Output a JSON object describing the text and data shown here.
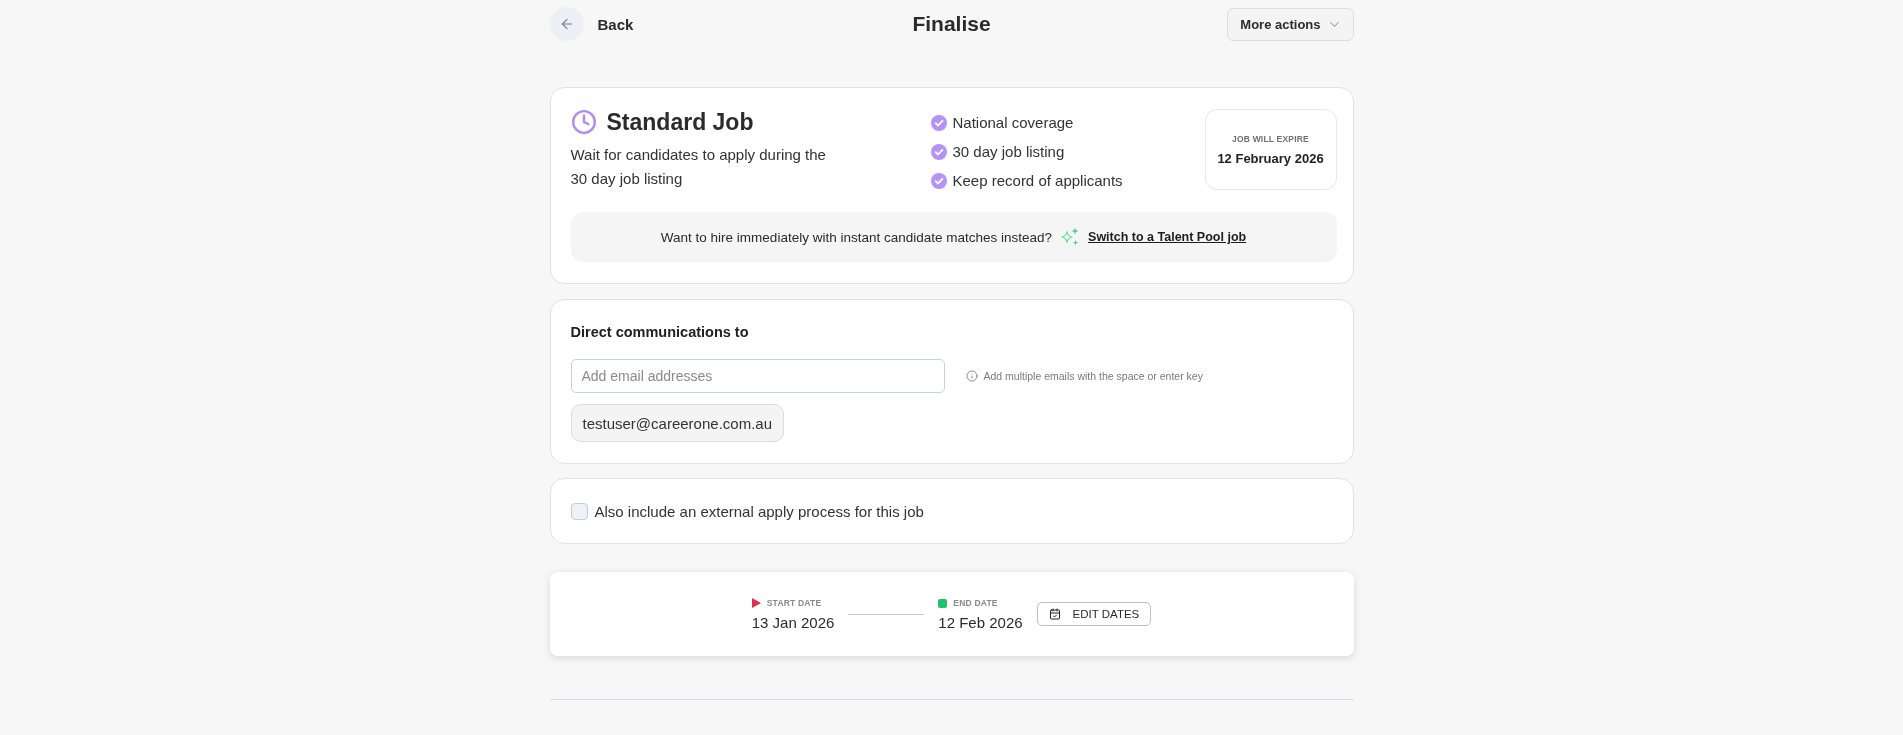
{
  "header": {
    "back_label": "Back",
    "title": "Finalise",
    "more_actions": "More actions"
  },
  "job_card": {
    "title": "Standard Job",
    "description": "Wait for candidates to apply during the 30 day job listing",
    "features": [
      "National coverage",
      "30 day job listing",
      "Keep record of applicants"
    ],
    "expiry": {
      "label": "JOB WILL EXPIRE",
      "date": "12 February 2026"
    },
    "promo": {
      "text": "Want to hire immediately with instant candidate matches instead?",
      "link": "Switch to a Talent Pool job"
    }
  },
  "communications": {
    "heading": "Direct communications to",
    "input": {
      "placeholder": "Add email addresses"
    },
    "hint": "Add multiple emails with the space or enter key",
    "emails": [
      "testuser@careerone.com.au"
    ]
  },
  "external_apply": {
    "label": "Also include an external apply process for this job",
    "checked": false
  },
  "dates": {
    "start": {
      "label": "START DATE",
      "value": "13 Jan 2026"
    },
    "end": {
      "label": "END DATE",
      "value": "12 Feb 2026"
    },
    "edit_button": "EDIT DATES"
  }
}
